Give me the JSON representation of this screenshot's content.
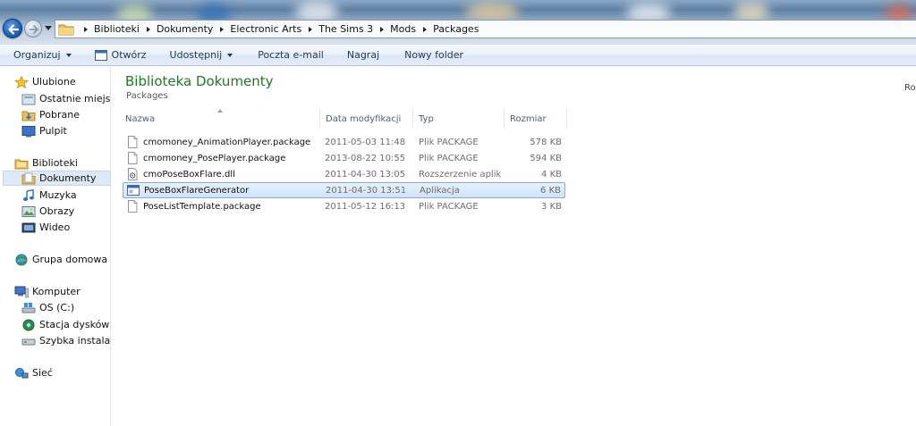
{
  "breadcrumb": [
    "Biblioteki",
    "Dokumenty",
    "Electronic Arts",
    "The Sims 3",
    "Mods",
    "Packages"
  ],
  "toolbar": {
    "organize": "Organizuj",
    "open": "Otwórz",
    "share": "Udostępnij",
    "email": "Poczta e-mail",
    "burn": "Nagraj",
    "new_folder": "Nowy folder"
  },
  "nav": {
    "favorites": "Ulubione",
    "recent": "Ostatnie miejsca",
    "downloads": "Pobrane",
    "desktop": "Pulpit",
    "libraries": "Biblioteki",
    "documents": "Dokumenty",
    "music": "Muzyka",
    "pictures": "Obrazy",
    "video": "Wideo",
    "homegroup": "Grupa domowa",
    "computer": "Komputer",
    "drive_c": "OS (C:)",
    "drive_dvd": "Stacja dysków DV",
    "quick_install": "Szybka instalacja",
    "network": "Sieć"
  },
  "library": {
    "title": "Biblioteka Dokumenty",
    "subtitle": "Packages",
    "arrange_partial": "Ro"
  },
  "columns": {
    "name": "Nazwa",
    "date": "Data modyfikacji",
    "type": "Typ",
    "size": "Rozmiar"
  },
  "files": [
    {
      "name": "cmomoney_AnimationPlayer.package",
      "date": "2011-05-03 11:48",
      "type": "Plik PACKAGE",
      "size": "578 KB",
      "icon": "document-icon"
    },
    {
      "name": "cmomoney_PosePlayer.package",
      "date": "2013-08-22 10:55",
      "type": "Plik PACKAGE",
      "size": "594 KB",
      "icon": "document-icon"
    },
    {
      "name": "cmoPoseBoxFlare.dll",
      "date": "2011-04-30 13:05",
      "type": "Rozszerzenie aplik...",
      "size": "4 KB",
      "icon": "dll-icon"
    },
    {
      "name": "PoseBoxFlareGenerator",
      "date": "2011-04-30 13:51",
      "type": "Aplikacja",
      "size": "6 KB",
      "icon": "application-icon"
    },
    {
      "name": "PoseListTemplate.package",
      "date": "2011-05-12 16:13",
      "type": "Plik PACKAGE",
      "size": "3 KB",
      "icon": "document-icon"
    }
  ],
  "colors": {
    "library_title": "#1e7a23",
    "selection": "#cfe3f8",
    "selection_border": "#84acdd"
  }
}
